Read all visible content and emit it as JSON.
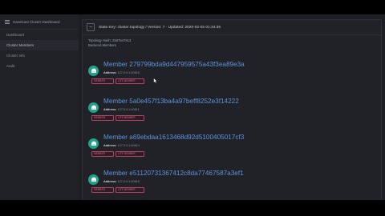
{
  "sidebar": {
    "header": "Hazelcast Cluster Dashboard",
    "items": [
      {
        "label": "Dashboard"
      },
      {
        "label": "Cluster Members"
      },
      {
        "label": "Cluster Info"
      },
      {
        "label": "Audit"
      }
    ]
  },
  "panel": {
    "collapse_icon": "−",
    "title": "State Key: cluster topology / Version: 7 · Updated: 2020-02-05 01:34:36",
    "topology_hash": "Topology Hash: 2587547613",
    "subtitle": "Backend Members"
  },
  "address_label": "Address:",
  "members": [
    {
      "id": "Member 279799bda9d447959575a43f3ea89e3a",
      "address": "127.0.0.1:40610",
      "tag_a": "MEMBER",
      "tag_b": "LITE MEMBER"
    },
    {
      "id": "Member 5a0e457f13ba4a97beff8252e3f14222",
      "address": "127.0.0.1:40611",
      "tag_a": "MEMBER",
      "tag_b": "LITE MEMBER"
    },
    {
      "id": "Member a69ebdaa1613468d92d5100405017cf3",
      "address": "127.0.0.1:40614",
      "tag_a": "MEMBER",
      "tag_b": "LITE MEMBER"
    },
    {
      "id": "Member e51120731367412c8da77467587a3ef1",
      "address": "127.0.0.1:40615",
      "tag_a": "MEMBER",
      "tag_b": "LITE MEMBER"
    }
  ],
  "colors": {
    "accent": "#5d93dd",
    "member_icon": "#20a38b",
    "tag_border": "#b83e63"
  }
}
